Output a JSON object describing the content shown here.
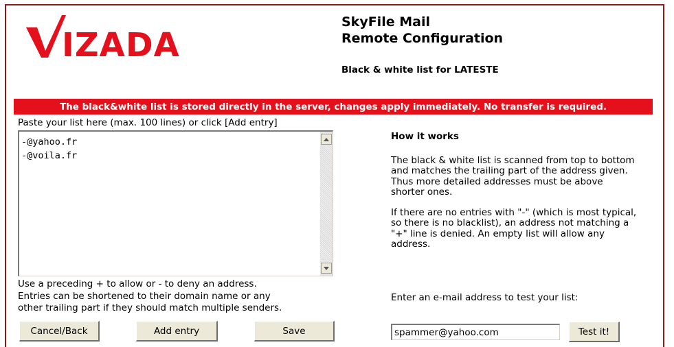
{
  "logo": {
    "text": "VIZADA",
    "color": "#e4111d"
  },
  "header": {
    "app_title_line1": "SkyFile Mail",
    "app_title_line2": "Remote Configuration",
    "list_title": "Black & white list for LATESTE"
  },
  "notice": "The black&white list is stored directly in the server, changes apply immediately. No transfer is required.",
  "editor": {
    "label": "Paste your list here (max. 100 lines) or click [Add entry]",
    "lines": [
      "-@yahoo.fr",
      "-@voila.fr"
    ],
    "help_lines": [
      "Use a preceding + to allow or - to deny an address.",
      "Entries can be shortened to their domain name or any",
      "other trailing part if they should match multiple senders."
    ]
  },
  "buttons": {
    "cancel": "Cancel/Back",
    "add_entry": "Add entry",
    "save": "Save",
    "test": "Test it!"
  },
  "how_it_works": {
    "title": "How it works",
    "paragraph1": "The black & white list is scanned from top to bottom and matches the trailing part of the address given. Thus more detailed addresses must be above shorter ones.",
    "paragraph2": "If there are no entries with \"-\" (which is most typical, so there is no blacklist), an address not matching a \"+\" line is denied. An empty list will allow any address."
  },
  "test": {
    "label": "Enter an e-mail address to test your list:",
    "value": "spammer@yahoo.com"
  }
}
